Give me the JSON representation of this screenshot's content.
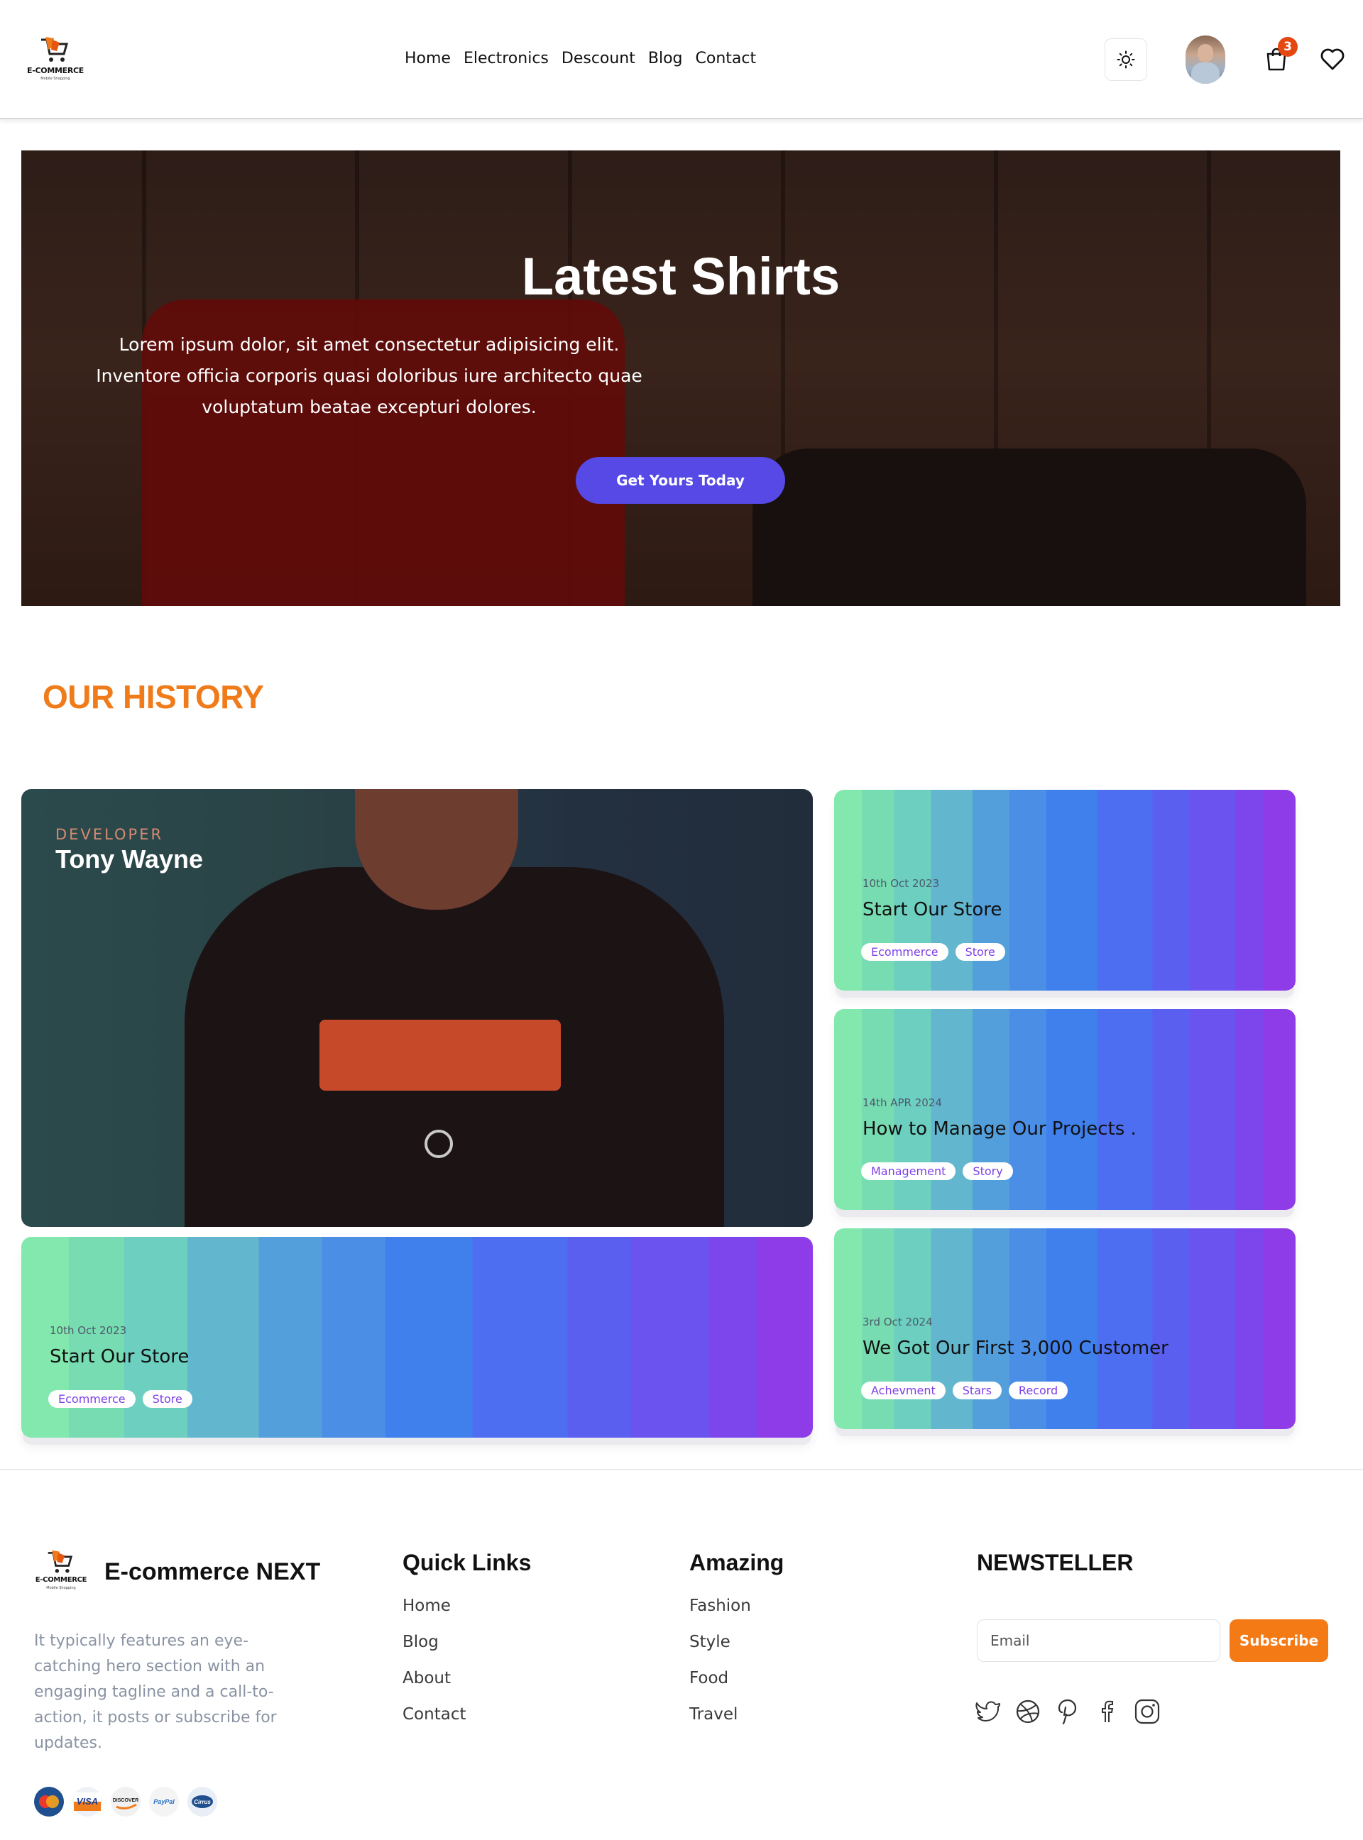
{
  "header": {
    "logo_text": "E-COMMERCE",
    "logo_sub": "Mobile Shopping",
    "nav": [
      "Home",
      "Electronics",
      "Descount",
      "Blog",
      "Contact"
    ],
    "cart_count": "3",
    "icons": [
      "sun-icon",
      "avatar",
      "shopping-bag-icon",
      "heart-icon"
    ]
  },
  "hero": {
    "title": "Latest Shirts",
    "description": "Lorem ipsum dolor, sit amet consectetur adipisicing elit. Inventore officia corporis quasi doloribus iure architecto quae voluptatum beatae excepturi dolores.",
    "button": "Get Yours Today"
  },
  "history": {
    "title": "OUR HISTORY",
    "developer": {
      "label": "DEVELOPER",
      "name": "Tony Wayne"
    },
    "stories": [
      {
        "date": "10th Oct 2023",
        "title": "Start Our Store",
        "tags": [
          "Ecommerce",
          "Store"
        ]
      },
      {
        "date": "14th APR 2024",
        "title": "How to Manage Our Projects .",
        "tags": [
          "Management",
          "Story"
        ]
      },
      {
        "date": "3rd Oct 2024",
        "title": "We Got Our First 3,000 Customer",
        "tags": [
          "Achevment",
          "Stars",
          "Record"
        ]
      },
      {
        "date": "10th Oct 2023",
        "title": "Start Our Store",
        "tags": [
          "Ecommerce",
          "Store"
        ]
      }
    ]
  },
  "footer": {
    "logo_text": "E-COMMERCE",
    "logo_sub": "Mobile Shopping",
    "brand": "E-commerce NEXT",
    "description": "It typically features an eye-catching hero section with an engaging tagline and a call-to-action, it posts or subscribe for updates.",
    "payments": [
      "MasterCard",
      "VISA",
      "DISCOVER",
      "PayPal",
      "Cirrus"
    ],
    "quick_links": {
      "title": "Quick Links",
      "items": [
        "Home",
        "Blog",
        "About",
        "Contact"
      ]
    },
    "amazing": {
      "title": "Amazing",
      "items": [
        "Fashion",
        "Style",
        "Food",
        "Travel"
      ]
    },
    "newsletter": {
      "title": "NEWSTELLER",
      "email_placeholder": "Email",
      "button": "Subscribe",
      "socials": [
        "twitter-icon",
        "dribbble-icon",
        "pinterest-icon",
        "facebook-icon",
        "instagram-icon"
      ]
    }
  },
  "colors": {
    "accent_orange": "#f07b1a",
    "button_purple": "#5649e6",
    "tag_purple": "#7d3fe6"
  }
}
